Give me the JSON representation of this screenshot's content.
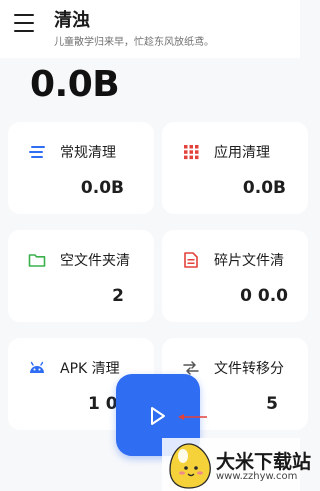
{
  "header": {
    "title": "清浊",
    "subtitle": "儿童散学归来早，忙趁东风放纸鸢。"
  },
  "summary": {
    "total_size": "0.0B"
  },
  "cards": [
    {
      "label": "常规清理",
      "value": "0.0B",
      "icon": "lines-icon"
    },
    {
      "label": "应用清理",
      "value": "0.0B",
      "icon": "grid-icon"
    },
    {
      "label": "空文件夹清",
      "value": "2",
      "icon": "folder-icon"
    },
    {
      "label": "碎片文件清",
      "value": "0 0.0",
      "icon": "document-icon"
    },
    {
      "label": "APK 清理",
      "value": "1 0.",
      "icon": "android-icon"
    },
    {
      "label": "文件转移分",
      "value": "5",
      "icon": "transfer-arrows-icon"
    }
  ],
  "fab": {
    "icon": "play-icon"
  },
  "watermark": {
    "title": "大米下载站",
    "url": "www.zzhyw.com"
  },
  "colors": {
    "accent": "#2f6df3",
    "red": "#e3423b",
    "green": "#3ab04a"
  }
}
